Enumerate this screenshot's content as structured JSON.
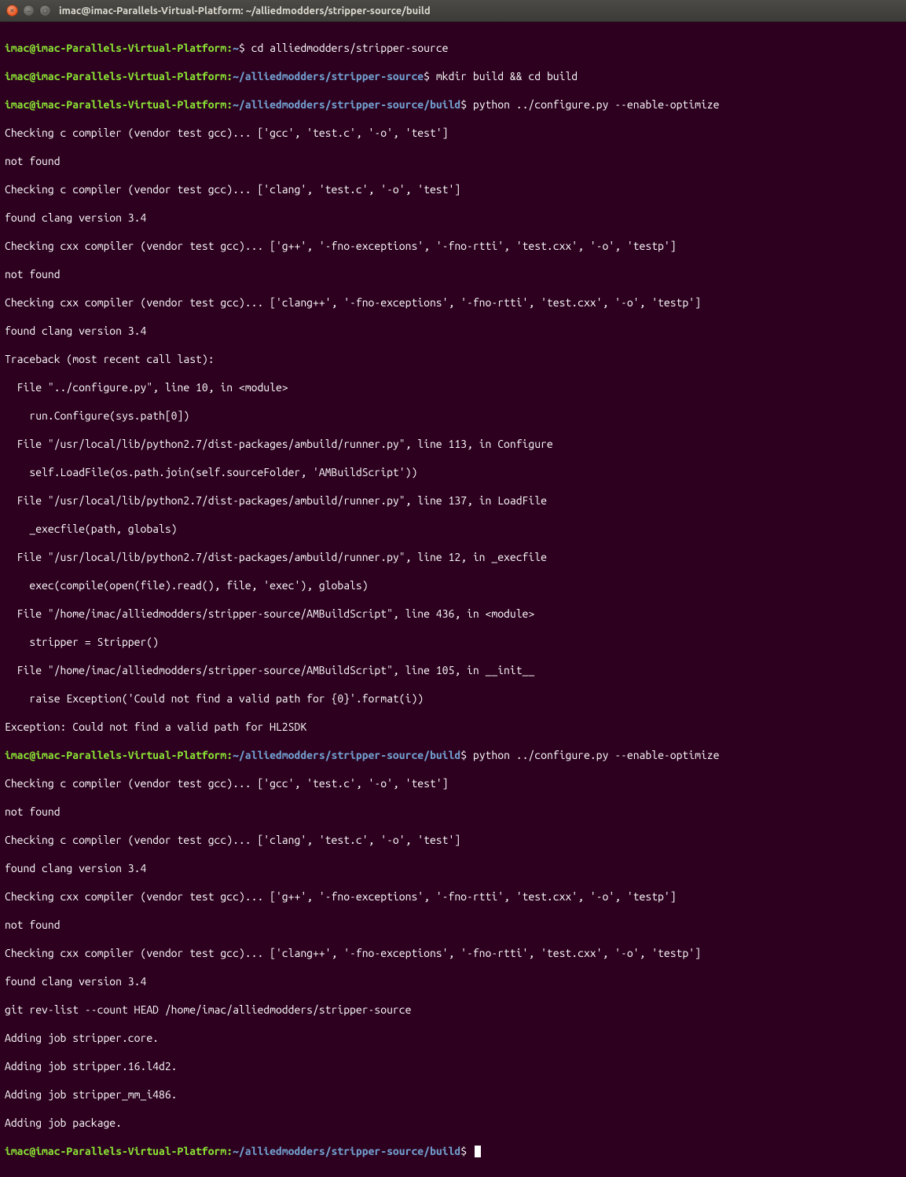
{
  "window": {
    "title": "imac@imac-Parallels-Virtual-Platform: ~/alliedmodders/stripper-source/build"
  },
  "prompt": {
    "user": "imac@imac-Parallels-Virtual-Platform",
    "path_home": "~",
    "path_src": "~/alliedmodders/stripper-source",
    "path_build": "~/alliedmodders/stripper-source/build",
    "dollar": "$"
  },
  "cmds": {
    "cd_src": "cd alliedmodders/stripper-source",
    "mkdir_build": "mkdir build && cd build",
    "configure": "python ../configure.py --enable-optimize",
    "empty": ""
  },
  "out": {
    "check_c_gcc": "Checking c compiler (vendor test gcc)... ['gcc', 'test.c', '-o', 'test']",
    "not_found": "not found",
    "check_c_clang": "Checking c compiler (vendor test gcc)... ['clang', 'test.c', '-o', 'test']",
    "found_clang": "found clang version 3.4",
    "check_cxx_gpp": "Checking cxx compiler (vendor test gcc)... ['g++', '-fno-exceptions', '-fno-rtti', 'test.cxx', '-o', 'testp']",
    "check_cxx_clangpp": "Checking cxx compiler (vendor test gcc)... ['clang++', '-fno-exceptions', '-fno-rtti', 'test.cxx', '-o', 'testp']",
    "tb_head": "Traceback (most recent call last):",
    "tb_conf_file": "  File \"../configure.py\", line 10, in <module>",
    "tb_conf_code": "    run.Configure(sys.path[0])",
    "tb_runner113_file": "  File \"/usr/local/lib/python2.7/dist-packages/ambuild/runner.py\", line 113, in Configure",
    "tb_runner113_code": "    self.LoadFile(os.path.join(self.sourceFolder, 'AMBuildScript'))",
    "tb_runner137_file": "  File \"/usr/local/lib/python2.7/dist-packages/ambuild/runner.py\", line 137, in LoadFile",
    "tb_runner137_code": "    _execfile(path, globals)",
    "tb_runner12_file": "  File \"/usr/local/lib/python2.7/dist-packages/ambuild/runner.py\", line 12, in _execfile",
    "tb_runner12_code": "    exec(compile(open(file).read(), file, 'exec'), globals)",
    "tb_ambs436_file": "  File \"/home/imac/alliedmodders/stripper-source/AMBuildScript\", line 436, in <module>",
    "tb_ambs436_code": "    stripper = Stripper()",
    "tb_ambs105_file": "  File \"/home/imac/alliedmodders/stripper-source/AMBuildScript\", line 105, in __init__",
    "tb_ambs105_code": "    raise Exception('Could not find a valid path for {0}'.format(i))",
    "exception": "Exception: Could not find a valid path for HL2SDK",
    "git_revlist": "git rev-list --count HEAD /home/imac/alliedmodders/stripper-source",
    "job_core": "Adding job stripper.core.",
    "job_l4d2": "Adding job stripper.16.l4d2.",
    "job_mm": "Adding job stripper_mm_i486.",
    "job_pkg": "Adding job package."
  }
}
